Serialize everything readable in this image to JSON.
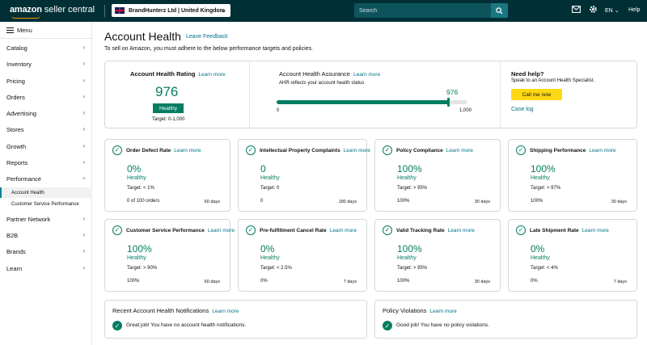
{
  "header": {
    "logo_brand": "amazon",
    "logo_product": "seller central",
    "account": "BrandHunterz Ltd | United Kingdom",
    "search_placeholder": "Search",
    "language": "EN",
    "help": "Help",
    "icons": [
      "mail-icon",
      "gear-icon",
      "globe-icon"
    ],
    "colors": {
      "bar": "#002f36",
      "accent": "#ff9900"
    }
  },
  "sidebar": {
    "menu_label": "Menu",
    "items": [
      {
        "label": "Catalog"
      },
      {
        "label": "Inventory"
      },
      {
        "label": "Pricing"
      },
      {
        "label": "Orders"
      },
      {
        "label": "Advertising"
      },
      {
        "label": "Stores"
      },
      {
        "label": "Growth"
      },
      {
        "label": "Reports"
      },
      {
        "label": "Performance",
        "expanded": true
      },
      {
        "label": "Partner Network"
      },
      {
        "label": "B2B"
      },
      {
        "label": "Brands"
      },
      {
        "label": "Learn"
      }
    ],
    "sub_items": [
      {
        "label": "Account Health",
        "active": true
      },
      {
        "label": "Customer Service Performance"
      }
    ]
  },
  "page": {
    "title": "Account Health",
    "feedback_link": "Leave Feedback",
    "intro": "To sell on Amazon, you must adhere to the below performance targets and policies."
  },
  "summary": {
    "ahr_title": "Account Health Rating",
    "learn_more": "Learn more",
    "ahr_score": "976",
    "ahr_status": "Healthy",
    "ahr_target": "Target: 0-1,000",
    "aha_title": "Account Health Assurance",
    "aha_desc": "AHR reflects your account health status",
    "aha_score": "976",
    "aha_score_value": 976,
    "aha_min": "0",
    "aha_max": "1,000",
    "aha_max_value": 1000,
    "help_title": "Need help?",
    "help_desc": "Speak to an Account Health Specialist.",
    "call_button": "Call me now",
    "case_log": "Case log",
    "colors": {
      "healthy": "#067d62",
      "call_button": "#ffd814",
      "link": "#007185"
    }
  },
  "metrics": [
    {
      "title": "Order Defect Rate",
      "link": "Learn more",
      "value": "0%",
      "status": "Healthy",
      "target": "Target: < 1%",
      "foot": "0 of 100 orders",
      "days": "60 days"
    },
    {
      "title": "Intellectual Property Complaints",
      "link": "Learn more",
      "value": "0",
      "status": "Healthy",
      "target": "Target: 0",
      "foot": "0",
      "days": "180 days"
    },
    {
      "title": "Policy Compliance",
      "link": "Learn more",
      "value": "100%",
      "status": "Healthy",
      "target": "Target: > 95%",
      "foot": "100%",
      "days": "30 days"
    },
    {
      "title": "Shipping Performance",
      "link": "Learn more",
      "value": "100%",
      "status": "Healthy",
      "target": "Target: > 97%",
      "foot": "100%",
      "days": "30 days"
    },
    {
      "title": "Customer Service Performance",
      "link": "Learn more",
      "value": "100%",
      "status": "Healthy",
      "target": "Target: > 90%",
      "foot": "100%",
      "days": "60 days"
    },
    {
      "title": "Pre-fulfillment Cancel Rate",
      "link": "Learn more",
      "value": "0%",
      "status": "Healthy",
      "target": "Target: < 2.5%",
      "foot": "0%",
      "days": "7 days"
    },
    {
      "title": "Valid Tracking Rate",
      "link": "Learn more",
      "value": "100%",
      "status": "Healthy",
      "target": "Target: > 95%",
      "foot": "100%",
      "days": "30 days"
    },
    {
      "title": "Late Shipment Rate",
      "link": "Learn more",
      "value": "0%",
      "status": "Healthy",
      "target": "Target: < 4%",
      "foot": "0%",
      "days": "7 days"
    }
  ],
  "notifications": {
    "title": "Recent Account Health Notifications",
    "link": "Learn more",
    "message": "Great job! You have no account health notifications."
  },
  "violations": {
    "title": "Policy Violations",
    "link": "Learn more",
    "message": "Good job! You have no policy violations."
  }
}
